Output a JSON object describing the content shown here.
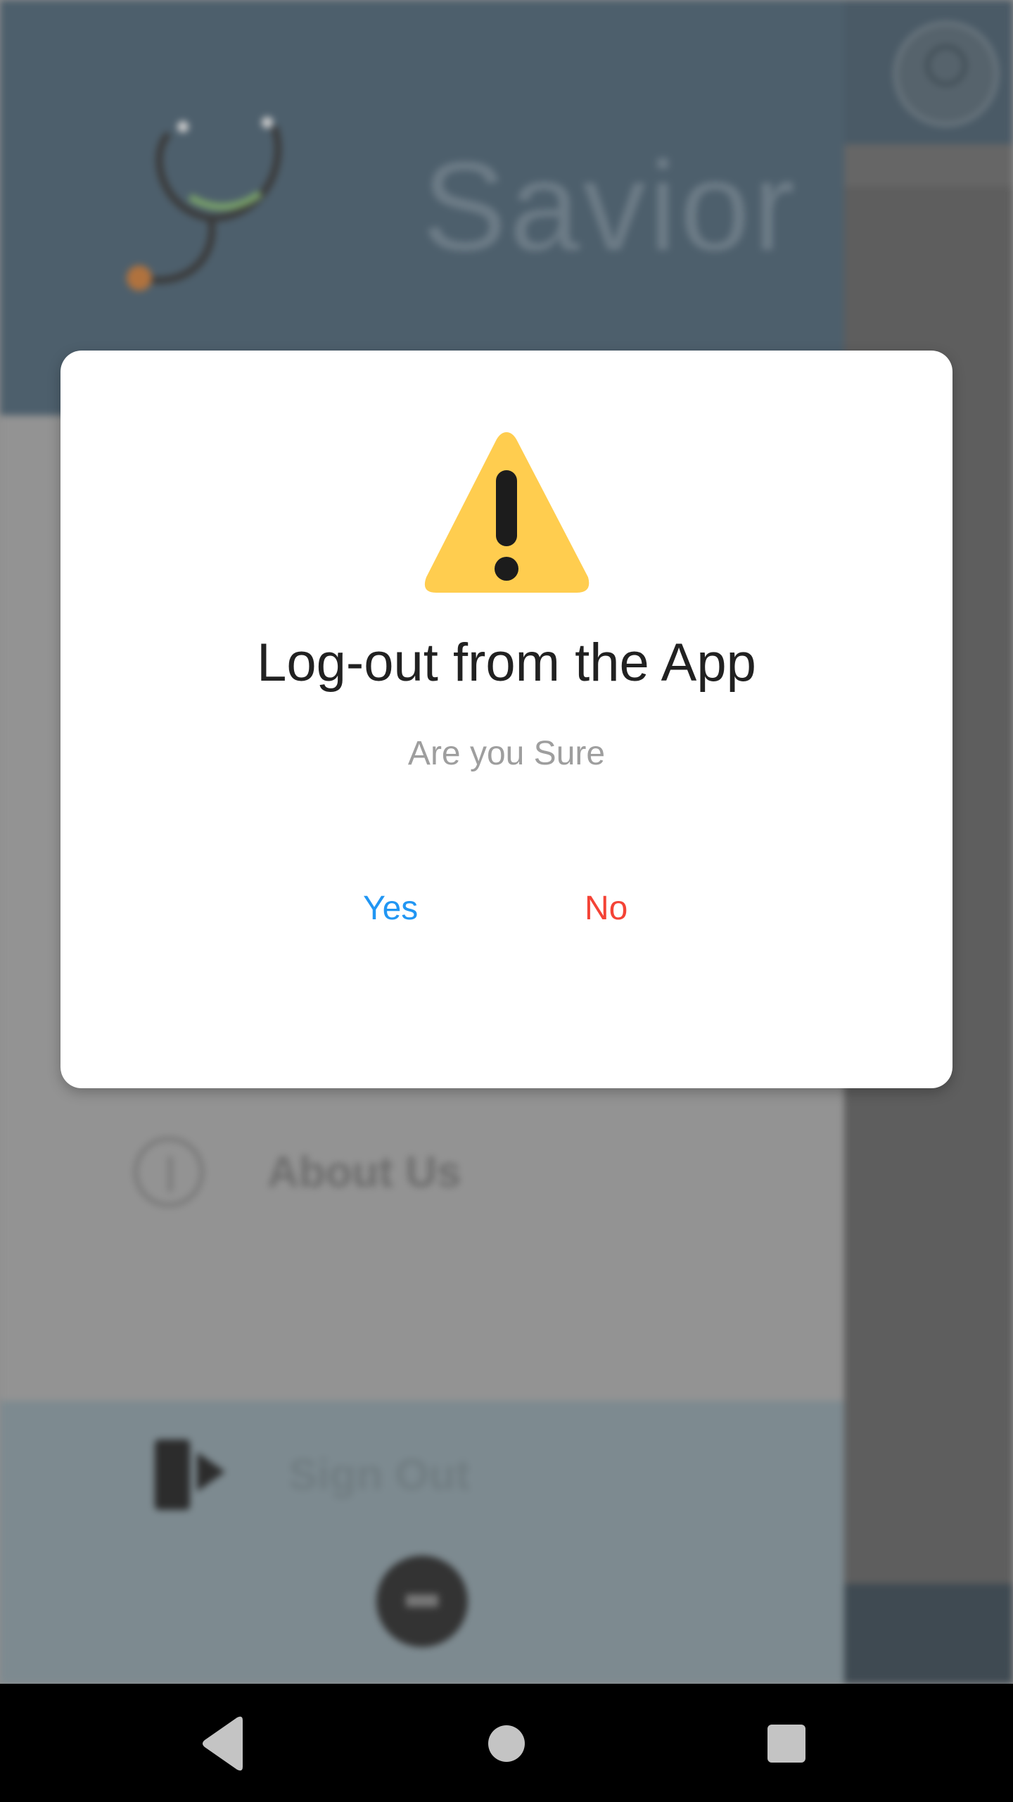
{
  "background": {
    "drawer": {
      "app_name": "Savior",
      "items": [
        {
          "label": "About Us",
          "icon": "info-icon"
        }
      ],
      "footer": {
        "sign_out_label": "Sign Out",
        "sign_out_icon": "sign-out-icon",
        "back_button_icon": "back-arrow-icon"
      }
    },
    "profile_icon": "profile-avatar-icon"
  },
  "dialog": {
    "icon": "warning-icon",
    "title": "Log-out from the App",
    "message": "Are you Sure",
    "confirm_label": "Yes",
    "cancel_label": "No"
  },
  "nav_bar": {
    "back_icon": "nav-back-icon",
    "home_icon": "nav-home-icon",
    "recents_icon": "nav-recents-icon"
  },
  "colors": {
    "warning_yellow": "#ffcd4f",
    "confirm_blue": "#2196f3",
    "cancel_red": "#f44336",
    "drawer_header": "#4d5f6c"
  }
}
